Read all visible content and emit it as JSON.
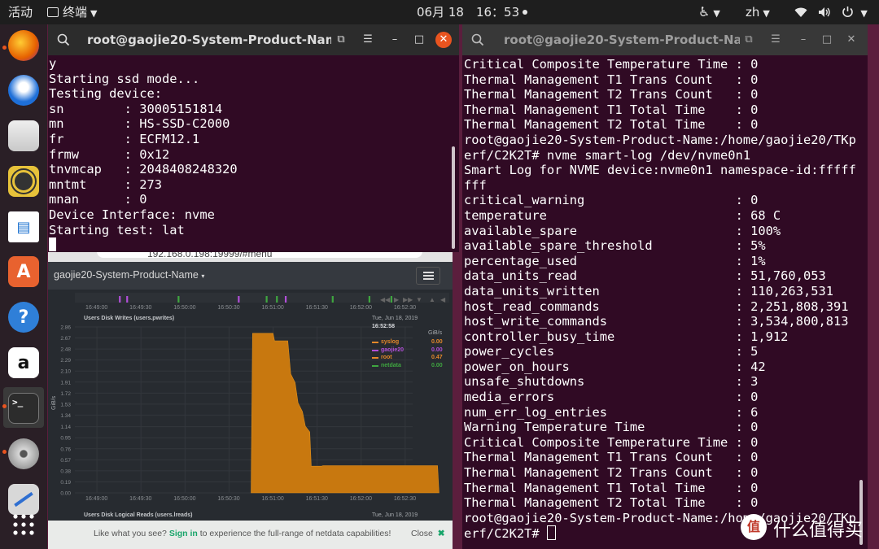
{
  "topbar": {
    "activities": "活动",
    "app_name": "终端",
    "clock": "06月 18　16：53",
    "input_method": "zh"
  },
  "dock": {
    "apps": [
      "firefox",
      "thunderbird",
      "files",
      "rhythmbox",
      "libreoffice-writer",
      "software-center",
      "help",
      "amazon",
      "terminal",
      "disks",
      "text-editor",
      "show-applications"
    ]
  },
  "left_terminal": {
    "title": "root@gaojie20-System-Product-Nam...",
    "lines": [
      "y",
      "Starting ssd mode...",
      "Testing device:",
      "sn        : 30005151814",
      "mn        : HS-SSD-C2000",
      "fr        : ECFM12.1",
      "frmw      : 0x12",
      "tnvmcap   : 2048408248320",
      "mntmt     : 273",
      "mnan      : 0",
      "Device Interface: nvme",
      "Starting test: lat"
    ]
  },
  "right_terminal": {
    "title": "root@gaojie20-System-Product-Na...",
    "lines": [
      "Critical Composite Temperature Time : 0",
      "Thermal Management T1 Trans Count   : 0",
      "Thermal Management T2 Trans Count   : 0",
      "Thermal Management T1 Total Time    : 0",
      "Thermal Management T2 Total Time    : 0",
      "root@gaojie20-System-Product-Name:/home/gaojie20/TKp",
      "erf/C2K2T# nvme smart-log /dev/nvme0n1",
      "Smart Log for NVME device:nvme0n1 namespace-id:fffff",
      "fff",
      "critical_warning                    : 0",
      "temperature                         : 68 C",
      "available_spare                     : 100%",
      "available_spare_threshold           : 5%",
      "percentage_used                     : 1%",
      "data_units_read                     : 51,760,053",
      "data_units_written                  : 110,263,531",
      "host_read_commands                  : 2,251,808,391",
      "host_write_commands                 : 3,534,800,813",
      "controller_busy_time                : 1,912",
      "power_cycles                        : 5",
      "power_on_hours                      : 42",
      "unsafe_shutdowns                    : 3",
      "media_errors                        : 0",
      "num_err_log_entries                 : 6",
      "Warning Temperature Time            : 0",
      "Critical Composite Temperature Time : 0",
      "Thermal Management T1 Trans Count   : 0",
      "Thermal Management T2 Trans Count   : 0",
      "Thermal Management T1 Total Time    : 0",
      "Thermal Management T2 Total Time    : 0",
      "root@gaojie20-System-Product-Name:/home/gaojie20/TKp"
    ],
    "prompt_last": "erf/C2K2T# "
  },
  "browser": {
    "url_fragment": "192.168.0.198:19999/#menu",
    "hostname": "gaojie20-System-Product-Name",
    "top_time_ticks": [
      "16:49:00",
      "16:49:30",
      "16:50:00",
      "16:50:30",
      "16:51:00",
      "16:51:30",
      "16:52:00",
      "16:52:30"
    ],
    "chart": {
      "title": "Users Disk Writes (users.pwrites)",
      "date": "Tue, Jun 18, 2019",
      "time": "16:52:58",
      "unit": "GiB/s",
      "ylabel": "GiB/s",
      "legend": [
        {
          "name": "syslog",
          "value": "0.00",
          "color": "#e6892a"
        },
        {
          "name": "gaojie20",
          "value": "0.00",
          "color": "#b14fd8"
        },
        {
          "name": "root",
          "value": "0.47",
          "color": "#e6892a"
        },
        {
          "name": "netdata",
          "value": "0.00",
          "color": "#3fa640"
        }
      ]
    },
    "next_chart_title": "Users Disk Logical Reads (users.lreads)",
    "next_chart_date": "Tue, Jun 18, 2019",
    "footer": {
      "prefix": "Like what you see?",
      "link": "Sign in",
      "suffix": "to experience the full-range of netdata capabilities!",
      "close": "Close"
    }
  },
  "watermark": "什么值得买",
  "chart_data": {
    "type": "area",
    "title": "Users Disk Writes (users.pwrites)",
    "xlabel": "",
    "ylabel": "GiB/s",
    "ylim": [
      0,
      2.86
    ],
    "yticks": [
      0.0,
      0.19,
      0.38,
      0.57,
      0.76,
      0.95,
      1.14,
      1.34,
      1.53,
      1.72,
      1.91,
      2.1,
      2.29,
      2.48,
      2.67,
      2.86
    ],
    "x_ticks": [
      "16:49:00",
      "16:49:30",
      "16:50:00",
      "16:50:30",
      "16:51:00",
      "16:51:30",
      "16:52:00",
      "16:52:30"
    ],
    "series": [
      {
        "name": "root",
        "color": "#c8780f",
        "x": [
          "16:50:45",
          "16:50:46",
          "16:51:00",
          "16:51:01",
          "16:51:10",
          "16:51:12",
          "16:51:15",
          "16:51:17",
          "16:51:20",
          "16:51:22",
          "16:51:25",
          "16:51:26",
          "16:51:33",
          "16:51:34",
          "16:52:52",
          "16:52:53"
        ],
        "values": [
          0,
          2.75,
          2.75,
          2.62,
          2.62,
          2.05,
          1.9,
          1.55,
          1.4,
          1.15,
          1.05,
          0.46,
          0.46,
          0.47,
          0.47,
          0
        ]
      }
    ],
    "grid": true,
    "legend_position": "top-right"
  }
}
